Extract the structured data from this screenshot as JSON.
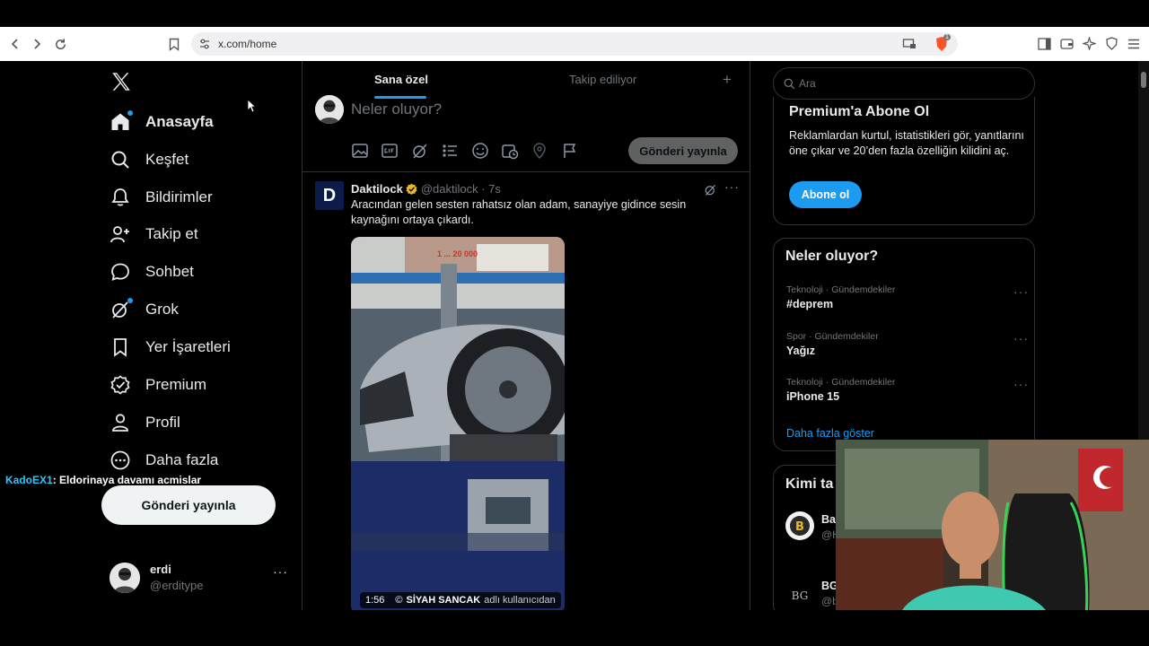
{
  "browser": {
    "url": "x.com/home",
    "shield_badge": "1"
  },
  "sidebar": {
    "items": [
      {
        "label": "Anasayfa",
        "icon": "home-icon"
      },
      {
        "label": "Keşfet",
        "icon": "search-icon"
      },
      {
        "label": "Bildirimler",
        "icon": "bell-icon"
      },
      {
        "label": "Takip et",
        "icon": "follow-icon"
      },
      {
        "label": "Sohbet",
        "icon": "chat-icon"
      },
      {
        "label": "Grok",
        "icon": "grok-icon"
      },
      {
        "label": "Yer İşaretleri",
        "icon": "bookmark-icon"
      },
      {
        "label": "Premium",
        "icon": "premium-icon"
      },
      {
        "label": "Profil",
        "icon": "profile-icon"
      },
      {
        "label": "Daha fazla",
        "icon": "more-circle-icon"
      }
    ],
    "post_button": "Gönderi yayınla",
    "user": {
      "name": "erdi",
      "handle": "@erditype"
    }
  },
  "chat_overlay": {
    "user": "KadoEX1",
    "message": ": Eldorinaya davamı acmislar"
  },
  "main": {
    "tabs": [
      {
        "label": "Sana özel",
        "active": true
      },
      {
        "label": "Takip ediliyor",
        "active": false
      }
    ],
    "compose": {
      "placeholder": "Neler oluyor?",
      "send_label": "Gönderi yayınla"
    },
    "tweet": {
      "avatar_letter": "D",
      "name": "Daktilock",
      "handle": "@daktilock · 7s",
      "text": "Aracından gelen sesten rahatsız olan adam, sanayiye gidince sesin kaynağını ortaya çıkardı.",
      "video_duration": "1:56",
      "video_credit_prefix": "©",
      "video_credit_name": "SİYAH SANCAK",
      "video_credit_suffix": "adlı kullanıcıdan",
      "sign_text": "1 ... 20 000"
    }
  },
  "right": {
    "search_placeholder": "Ara",
    "premium": {
      "title": "Premium'a Abone Ol",
      "text": "Reklamlardan kurtul, istatistikleri gör, yanıtlarını öne çıkar ve 20’den fazla özelliğin kilidini aç.",
      "button": "Abone ol"
    },
    "trends": {
      "title": "Neler oluyor?",
      "items": [
        {
          "meta": "Teknoloji · Gündemdekiler",
          "topic": "#deprem"
        },
        {
          "meta": "Spor · Gündemdekiler",
          "topic": "Yağız"
        },
        {
          "meta": "Teknoloji · Gündemdekiler",
          "topic": "iPhone 15"
        }
      ],
      "show_more": "Daha fazla göster"
    },
    "who_to_follow": {
      "title": "Kimi ta",
      "items": [
        {
          "name": "Ba",
          "handle": "@H"
        },
        {
          "name": "BG",
          "handle": "@b"
        }
      ]
    }
  },
  "colors": {
    "accent": "#1d9bf0",
    "background": "#000000",
    "border": "#2f3336",
    "text": "#e7e9ea",
    "muted": "#71767b"
  }
}
